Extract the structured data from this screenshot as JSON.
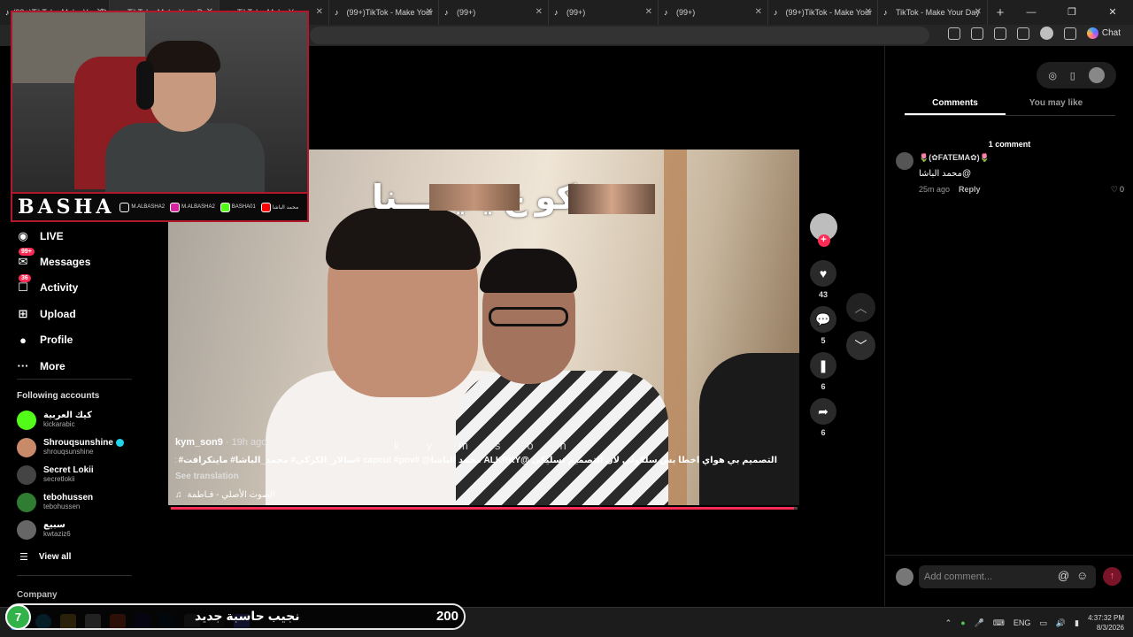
{
  "browser": {
    "tabs": [
      {
        "label": "(99+)TikTok - Make Your Day",
        "active": false
      },
      {
        "label": "TikTok - Make Your Day",
        "active": true
      },
      {
        "label": "TikTok - Make Your",
        "active": false
      },
      {
        "label": "(99+)TikTok - Make Your",
        "active": false
      },
      {
        "label": "(99+)",
        "active": false
      },
      {
        "label": "(99+)",
        "active": false
      },
      {
        "label": "(99+)",
        "active": false
      },
      {
        "label": "(99+)TikTok - Make Your",
        "active": false
      },
      {
        "label": "TikTok - Make Your Day",
        "active": false
      }
    ],
    "chat_label": "Chat",
    "window_controls": [
      "—",
      "❐",
      "✕"
    ]
  },
  "overlay_banner": {
    "brand": "BASHA",
    "socials": [
      {
        "icon": "tiktok-icon",
        "handle": "M.ALBASHA2",
        "color": "#111111"
      },
      {
        "icon": "instagram-icon",
        "handle": "M.ALBASHA2",
        "color": "#d6249f"
      },
      {
        "icon": "kick-icon",
        "handle": "BASHA01",
        "color": "#53fc18"
      },
      {
        "icon": "youtube-icon",
        "handle": "محمد الباشا",
        "color": "#ff0000"
      }
    ]
  },
  "sidebar": {
    "items": [
      {
        "label": "LIVE",
        "icon": "live-icon",
        "badge": ""
      },
      {
        "label": "Messages",
        "icon": "messages-icon",
        "badge": "99+"
      },
      {
        "label": "Activity",
        "icon": "activity-icon",
        "badge": "36"
      },
      {
        "label": "Upload",
        "icon": "upload-icon",
        "badge": ""
      },
      {
        "label": "Profile",
        "icon": "profile-icon",
        "badge": ""
      },
      {
        "label": "More",
        "icon": "more-icon",
        "badge": ""
      }
    ],
    "following_title": "Following accounts",
    "accounts": [
      {
        "name": "كيك العربية",
        "handle": "kickarabic",
        "verified": false,
        "avatar_color": "#53fc18"
      },
      {
        "name": "Shrouqsunshine",
        "handle": "shrouqsunshine",
        "verified": true,
        "avatar_color": "#c98a6a"
      },
      {
        "name": "Secret Lokii",
        "handle": "secretlokii",
        "verified": false,
        "avatar_color": "#444444"
      },
      {
        "name": "tebohussen",
        "handle": "tebohussen",
        "verified": false,
        "avatar_color": "#2e7d32"
      },
      {
        "name": "سبيع",
        "handle": "kwtaziz6",
        "verified": false,
        "avatar_color": "#666666"
      }
    ],
    "view_all": "View all",
    "company": "Company"
  },
  "video": {
    "caption_overlay": "ضحكو ع ينيـ ـــنا",
    "watermark": "kymson",
    "author": "kym_son9",
    "posted": " · 19h ago",
    "description": "التصميم بي هواي اخطأ بس سلكولي لان التصميم تسليكي @ALKRKY محمد الباشا@ #capcut #pov #سالار_الكركي# محمد_الباشا# ماينكرافت# fyp#fyp⁄ #fyp #minecraft",
    "see_translation": "See translation",
    "music": "الصوت الأصلي - فـاطمة",
    "progress": 0.995
  },
  "actions": {
    "likes": "43",
    "comments": "5",
    "saves": "6",
    "shares": "6"
  },
  "comments_panel": {
    "tabs": [
      "Comments",
      "You may like"
    ],
    "count_label": "1 comment",
    "comments": [
      {
        "user": "🌷(✿FATEMA✿)🌷",
        "text": "محمد الباشا@",
        "time": "25m ago",
        "reply": "Reply",
        "likes": "0"
      }
    ],
    "input_placeholder": "Add comment..."
  },
  "taskbar": {
    "lang": "ENG",
    "time": "4:37:32 PM",
    "date": "8/3/2026"
  },
  "alert": {
    "badge": "7",
    "text": "نجيب حاسبة جديد",
    "value": "200"
  },
  "colors": {
    "accent": "#fe2c55",
    "banner_red": "#b3172c"
  }
}
